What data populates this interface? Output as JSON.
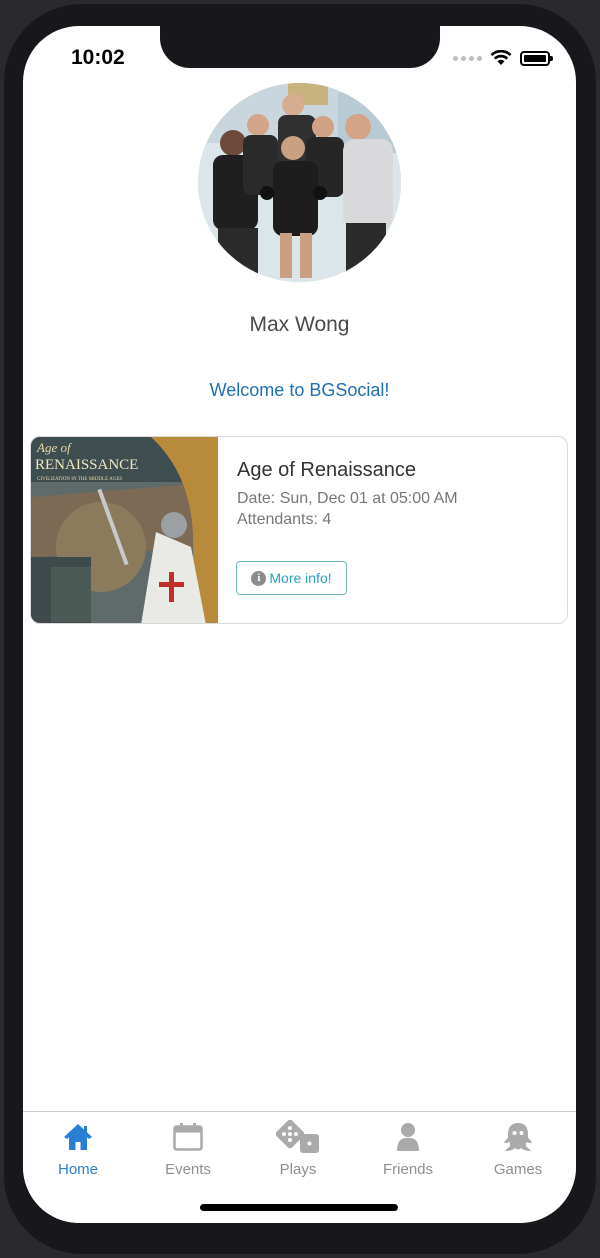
{
  "status_bar": {
    "time": "10:02"
  },
  "profile": {
    "name": "Max Wong",
    "welcome": "Welcome to BGSocial!"
  },
  "event": {
    "title": "Age of Renaissance",
    "date": "Date: Sun, Dec 01 at 05:00 AM",
    "attendants": "Attendants: 4",
    "button_label": "More info!",
    "image_text_top": "Age of",
    "image_text_main": "RENAISSANCE",
    "image_text_sub": "CIVILIZATION IN THE MIDDLE AGES"
  },
  "tabs": [
    {
      "label": "Home",
      "icon": "home-icon",
      "active": true
    },
    {
      "label": "Events",
      "icon": "calendar-icon",
      "active": false
    },
    {
      "label": "Plays",
      "icon": "dice-icon",
      "active": false
    },
    {
      "label": "Friends",
      "icon": "user-icon",
      "active": false
    },
    {
      "label": "Games",
      "icon": "ghost-icon",
      "active": false
    }
  ],
  "colors": {
    "accent": "#2a7fd4",
    "welcome_text": "#1f6fb2",
    "button_border": "#6fb7c9",
    "button_text": "#2b9fbf",
    "inactive_tab": "#8e8e8e"
  }
}
